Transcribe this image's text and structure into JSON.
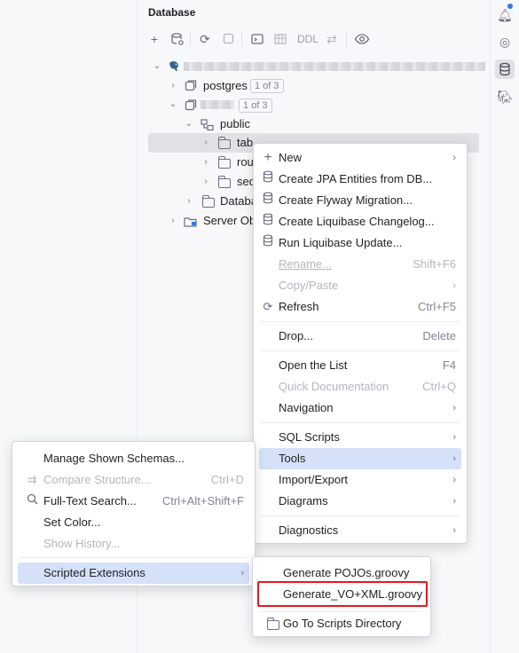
{
  "panel": {
    "title": "Database"
  },
  "toolbar": {
    "ddl_label": "DDL"
  },
  "tree": {
    "postgres": {
      "label": "postgres",
      "badge": "1 of 3"
    },
    "second_db": {
      "badge": "1 of 3"
    },
    "public": {
      "label": "public"
    },
    "tables": {
      "label": "tab"
    },
    "routines": {
      "label": "rou"
    },
    "sequences": {
      "label": "seq"
    },
    "database_objects": {
      "label": "Databa"
    },
    "server_objects": {
      "label": "Server Obj"
    }
  },
  "context_menu": {
    "items": [
      {
        "label": "New",
        "icon": "plus-icon",
        "submenu": true
      },
      {
        "label": "Create JPA Entities from DB...",
        "icon": "database-icon"
      },
      {
        "label": "Create Flyway Migration...",
        "icon": "database-icon"
      },
      {
        "label": "Create Liquibase Changelog...",
        "icon": "database-icon"
      },
      {
        "label": "Run Liquibase Update...",
        "icon": "database-icon"
      },
      {
        "label": "Rename...",
        "shortcut": "Shift+F6",
        "disabled": true
      },
      {
        "label": "Copy/Paste",
        "submenu": true,
        "disabled": true
      },
      {
        "label": "Refresh",
        "shortcut": "Ctrl+F5",
        "icon": "refresh-icon"
      },
      {
        "label": "Drop...",
        "shortcut": "Delete"
      },
      {
        "label": "Open the List",
        "shortcut": "F4"
      },
      {
        "label": "Quick Documentation",
        "shortcut": "Ctrl+Q",
        "disabled": true
      },
      {
        "label": "Navigation",
        "submenu": true
      },
      {
        "label": "SQL Scripts",
        "submenu": true
      },
      {
        "label": "Tools",
        "submenu": true,
        "highlighted": true
      },
      {
        "label": "Import/Export",
        "submenu": true
      },
      {
        "label": "Diagrams",
        "submenu": true
      },
      {
        "label": "Diagnostics",
        "submenu": true
      }
    ]
  },
  "tools_menu": {
    "items": [
      {
        "label": "Manage Shown Schemas..."
      },
      {
        "label": "Compare Structure...",
        "shortcut": "Ctrl+D",
        "disabled": true,
        "icon": "compare-icon"
      },
      {
        "label": "Full-Text Search...",
        "shortcut": "Ctrl+Alt+Shift+F",
        "icon": "search-icon"
      },
      {
        "label": "Set Color..."
      },
      {
        "label": "Show History...",
        "disabled": true
      },
      {
        "label": "Scripted Extensions",
        "submenu": true,
        "highlighted": true
      }
    ]
  },
  "extensions_menu": {
    "items": [
      {
        "label": "Generate POJOs.groovy"
      },
      {
        "label": "Generate_VO+XML.groovy",
        "outlined": true,
        "outline_color": "#e5181e"
      },
      {
        "label": "Go To Scripts Directory",
        "icon": "folder-icon"
      }
    ]
  },
  "colors": {
    "highlight": "#d5e1f9",
    "selection": "#dfe1e5",
    "accent": "#3574f0"
  }
}
